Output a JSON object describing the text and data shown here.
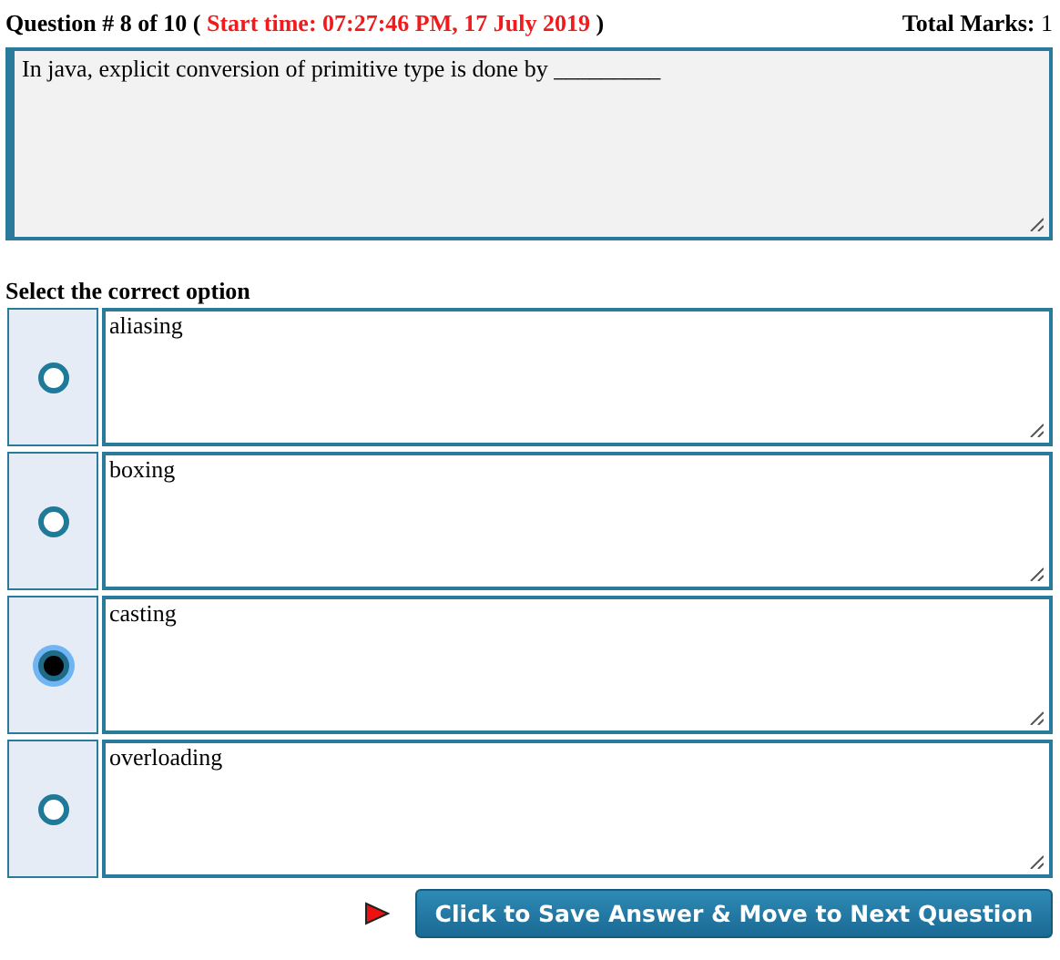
{
  "header": {
    "question_label": "Question # 8 of 10 (",
    "start_time": "Start time: 07:27:46 PM, 17 July 2019",
    "close_paren": ")",
    "total_marks_label": "Total Marks:",
    "total_marks": "1"
  },
  "question": {
    "text": "In java, explicit conversion of primitive type is done by _________"
  },
  "options_heading": "Select the correct option",
  "options": [
    {
      "text": "aliasing",
      "selected": false
    },
    {
      "text": "boxing",
      "selected": false
    },
    {
      "text": "casting",
      "selected": true
    },
    {
      "text": "overloading",
      "selected": false
    }
  ],
  "submit_button": "Click to Save Answer & Move to Next Question"
}
